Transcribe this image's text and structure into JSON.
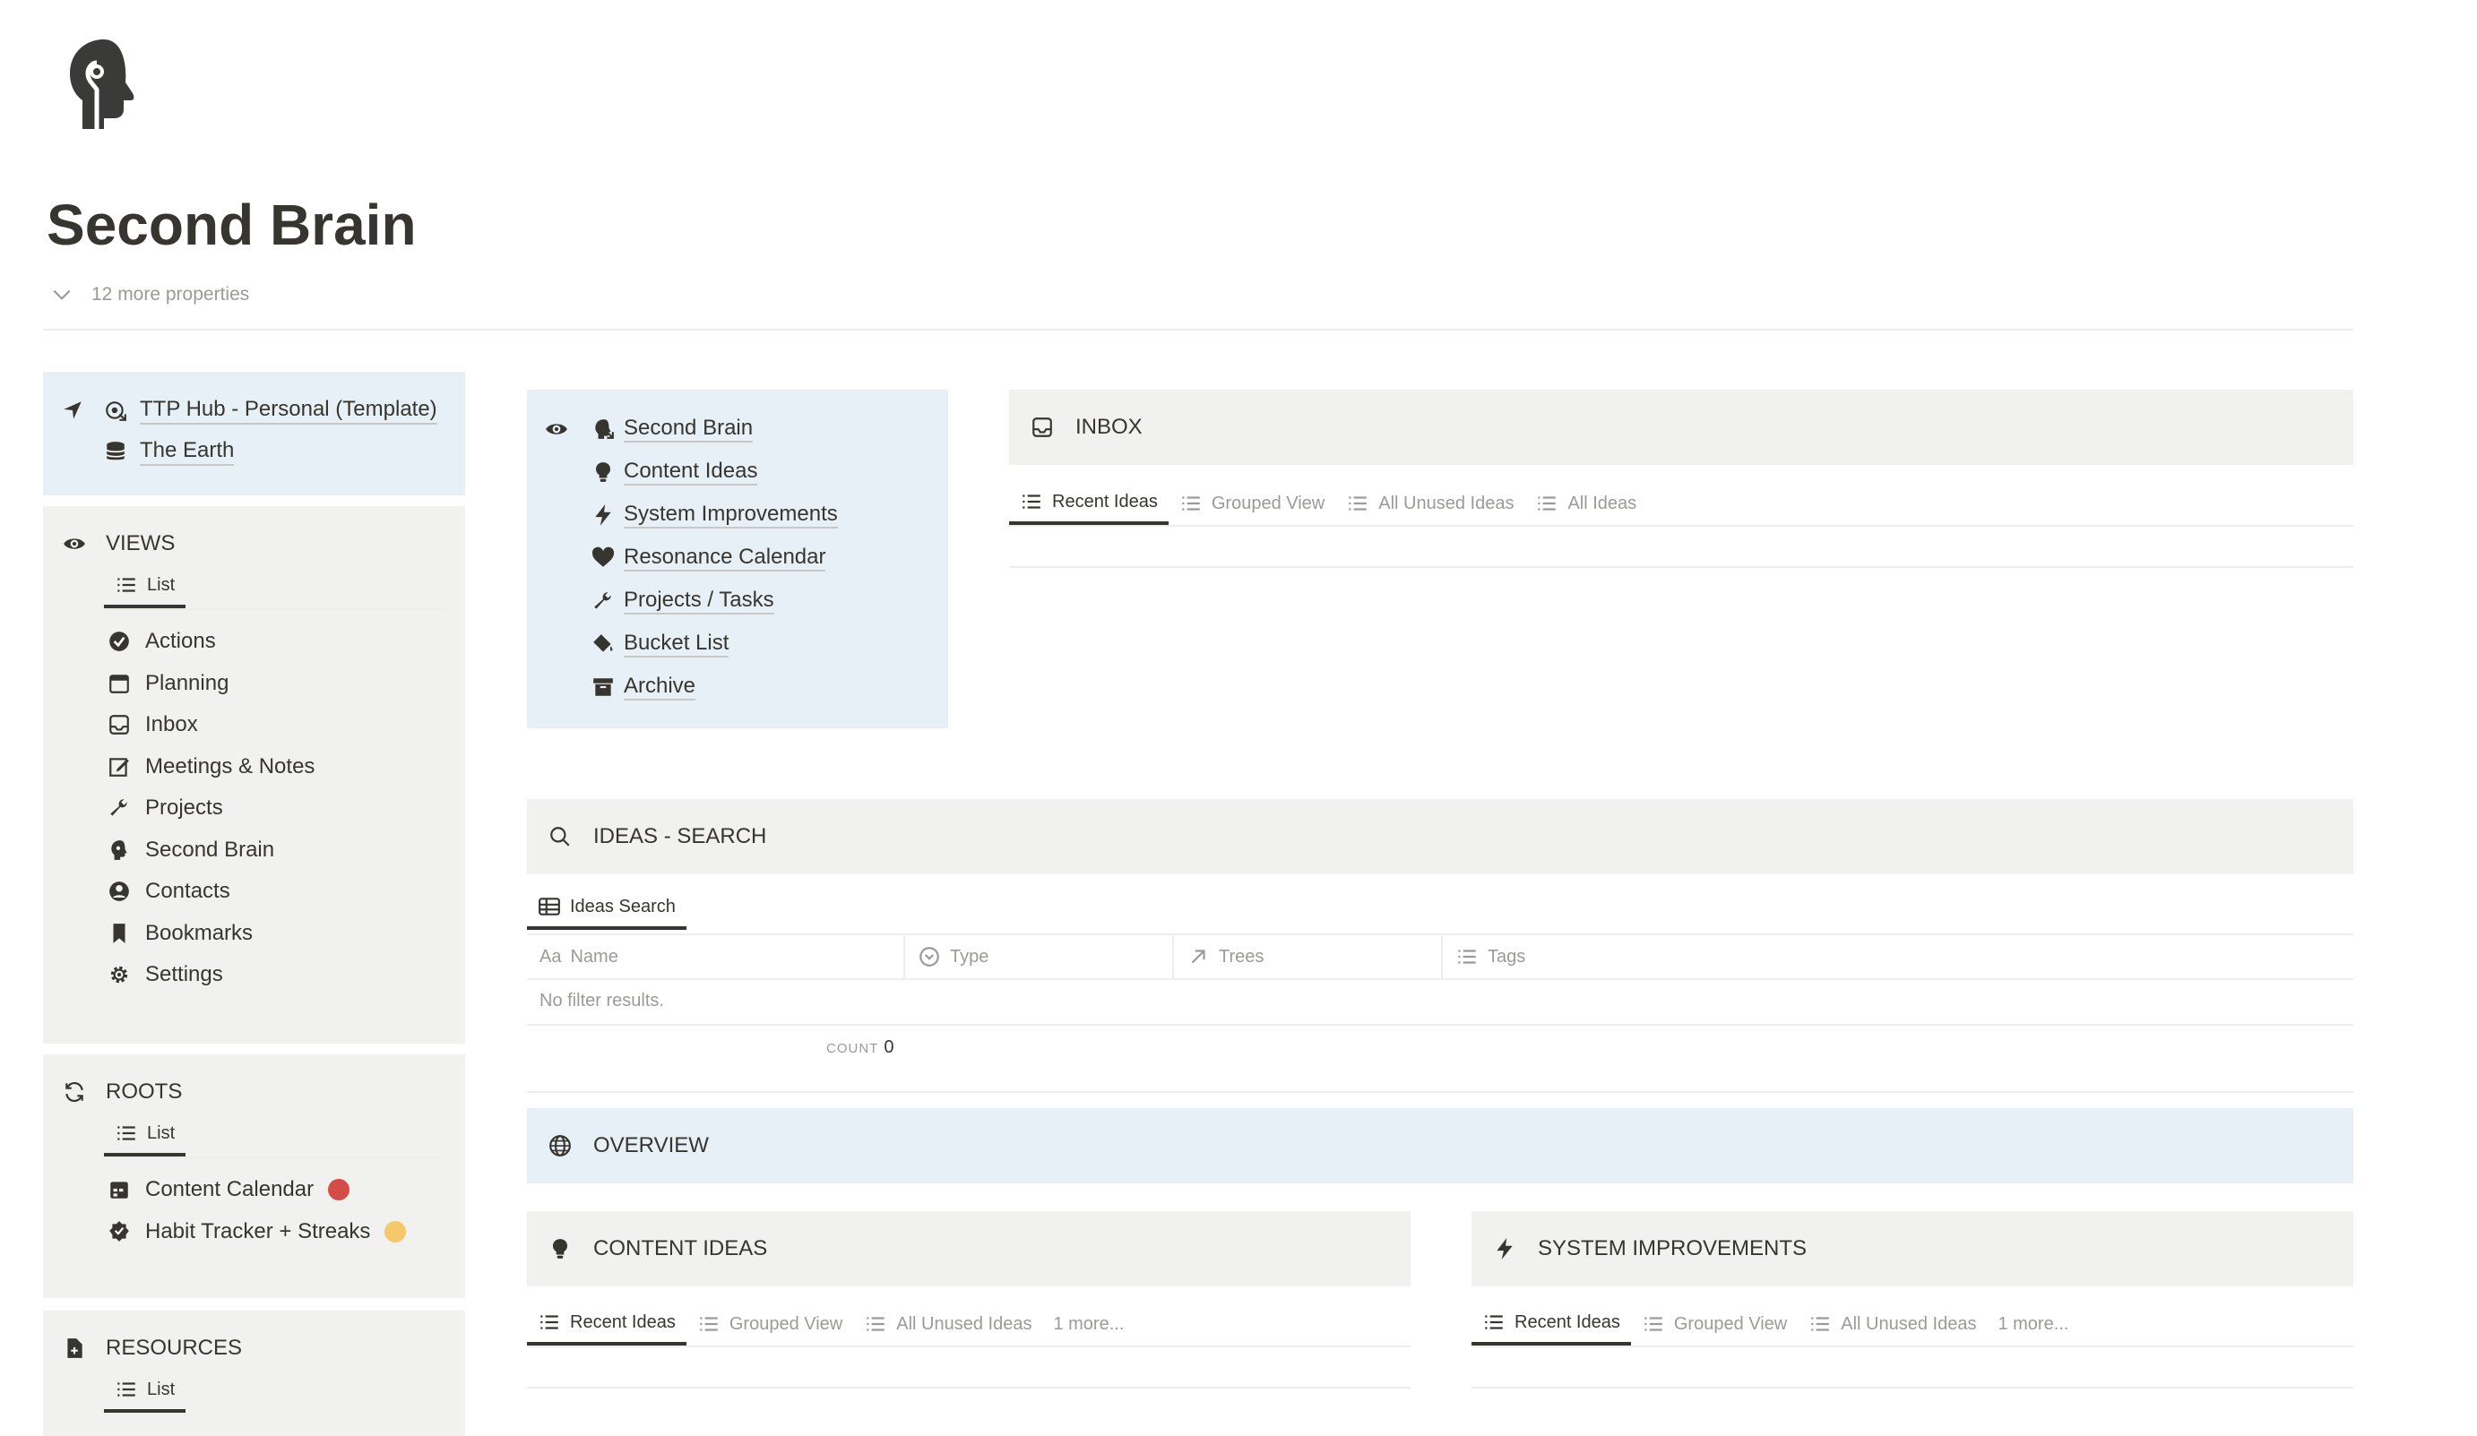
{
  "page": {
    "title": "Second Brain",
    "more_properties": "12 more properties"
  },
  "breadcrumb_panel": {
    "links": [
      {
        "label": "TTP Hub - Personal (Template)",
        "icon": "hub-icon"
      },
      {
        "label": "The Earth",
        "icon": "database-icon"
      }
    ]
  },
  "views_panel": {
    "heading": "VIEWS",
    "tab": "List",
    "items": [
      {
        "label": "Actions",
        "icon": "check-circle-icon"
      },
      {
        "label": "Planning",
        "icon": "calendar-icon"
      },
      {
        "label": "Inbox",
        "icon": "inbox-icon"
      },
      {
        "label": "Meetings & Notes",
        "icon": "edit-icon"
      },
      {
        "label": "Projects",
        "icon": "wrench-icon"
      },
      {
        "label": "Second Brain",
        "icon": "brain-head-icon"
      },
      {
        "label": "Contacts",
        "icon": "person-circle-icon"
      },
      {
        "label": "Bookmarks",
        "icon": "bookmark-icon"
      },
      {
        "label": "Settings",
        "icon": "gear-icon"
      }
    ]
  },
  "roots_panel": {
    "heading": "ROOTS",
    "tab": "List",
    "items": [
      {
        "label": "Content Calendar",
        "icon": "calendar-dark-icon",
        "dot_color": "#d44c47"
      },
      {
        "label": "Habit Tracker + Streaks",
        "icon": "badge-check-icon",
        "dot_color": "#f5c96a"
      }
    ]
  },
  "resources_panel": {
    "heading": "RESOURCES",
    "tab": "List"
  },
  "nav_box": {
    "items": [
      {
        "label": "Second Brain",
        "icon": "brain-head-icon"
      },
      {
        "label": "Content Ideas",
        "icon": "lightbulb-icon"
      },
      {
        "label": "System Improvements",
        "icon": "bolt-icon"
      },
      {
        "label": "Resonance Calendar",
        "icon": "heart-icon"
      },
      {
        "label": "Projects / Tasks",
        "icon": "wrench-icon"
      },
      {
        "label": "Bucket List",
        "icon": "paint-bucket-icon"
      },
      {
        "label": "Archive",
        "icon": "archive-icon"
      }
    ]
  },
  "inbox": {
    "heading": "INBOX",
    "tabs": [
      "Recent Ideas",
      "Grouped View",
      "All Unused Ideas",
      "All Ideas"
    ]
  },
  "ideas_search": {
    "heading": "IDEAS - SEARCH",
    "tab": "Ideas Search",
    "columns": [
      {
        "prefix": "Aa",
        "label": "Name"
      },
      {
        "label": "Type"
      },
      {
        "label": "Trees"
      },
      {
        "label": "Tags"
      }
    ],
    "empty": "No filter results.",
    "count_label": "COUNT",
    "count_value": "0"
  },
  "overview": {
    "heading": "OVERVIEW"
  },
  "content_ideas": {
    "heading": "CONTENT IDEAS",
    "tabs": [
      "Recent Ideas",
      "Grouped View",
      "All Unused Ideas"
    ],
    "more": "1 more..."
  },
  "system_improvements": {
    "heading": "SYSTEM IMPROVEMENTS",
    "tabs": [
      "Recent Ideas",
      "Grouped View",
      "All Unused Ideas"
    ],
    "more": "1 more..."
  },
  "colors": {
    "text": "#37352f",
    "muted": "#9b9a97",
    "blue_panel": "#e7f0f6",
    "gray_panel": "#f1f1ef",
    "red_dot": "#d44c47",
    "yellow_dot": "#f5c96a"
  }
}
